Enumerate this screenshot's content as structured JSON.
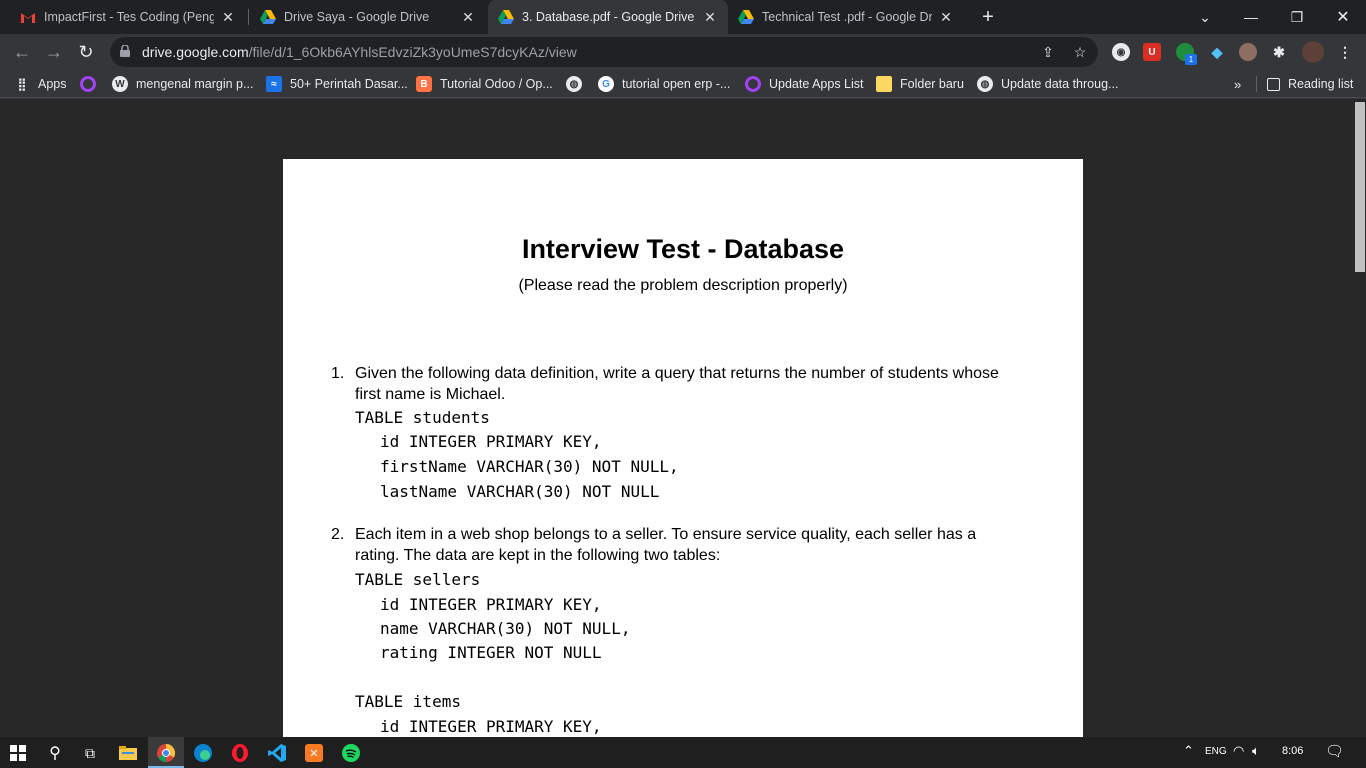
{
  "tabs": [
    {
      "title": "ImpactFirst - Tes Coding (Pengem",
      "icon": "gmail-icon"
    },
    {
      "title": "Drive Saya - Google Drive",
      "icon": "google-drive-icon"
    },
    {
      "title": "3. Database.pdf - Google Drive",
      "icon": "google-drive-icon",
      "active": true
    },
    {
      "title": "Technical Test .pdf - Google Drive",
      "icon": "google-drive-icon"
    }
  ],
  "omnibox": {
    "host": "drive.google.com",
    "path": "/file/d/1_6Okb6AYhlsEdvziZk3yoUmeS7dcyKAz/view"
  },
  "extensions": {
    "badge_count": "1"
  },
  "bookmarks": [
    {
      "label": "Apps"
    },
    {
      "label": ""
    },
    {
      "label": "mengenal margin p..."
    },
    {
      "label": "50+ Perintah Dasar..."
    },
    {
      "label": "Tutorial Odoo / Op..."
    },
    {
      "label": ""
    },
    {
      "label": "tutorial open erp -..."
    },
    {
      "label": "Update Apps List"
    },
    {
      "label": "Folder baru"
    },
    {
      "label": "Update data throug..."
    }
  ],
  "bookmarks_overflow": "»",
  "reading_list": "Reading list",
  "document": {
    "title": "Interview Test - Database",
    "subtitle": "(Please read the problem description properly)",
    "q1": {
      "num": "1.",
      "text": "Given the following data definition, write a query that returns the number of students whose first name is Michael.",
      "code": [
        "TABLE students",
        "id INTEGER PRIMARY KEY,",
        "firstName VARCHAR(30) NOT NULL,",
        "lastName VARCHAR(30) NOT NULL"
      ]
    },
    "q2": {
      "num": "2.",
      "text": "Each item in a web shop belongs to a seller. To ensure service quality, each seller has a rating. The data are kept in the following two tables:",
      "code": [
        "TABLE sellers",
        "id INTEGER PRIMARY KEY,",
        "name VARCHAR(30) NOT NULL,",
        "rating INTEGER NOT NULL",
        "TABLE items",
        "id INTEGER PRIMARY KEY,"
      ]
    }
  },
  "taskbar": {
    "time": "8:06",
    "lang": "ENG"
  },
  "colors": {
    "accent": "#76b9ed",
    "page_bg": "#ffffff",
    "viewer_bg": "#282828"
  }
}
